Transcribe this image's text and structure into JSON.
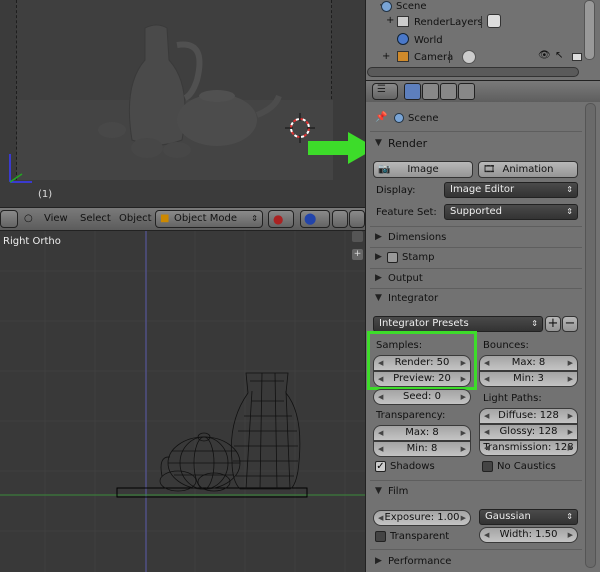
{
  "render_area": {
    "frame": "(1)"
  },
  "viewport_header": {
    "view": "View",
    "select": "Select",
    "object": "Object",
    "mode": "Object Mode"
  },
  "viewport": {
    "label": "Right Ortho"
  },
  "outliner": {
    "items": [
      {
        "label": "Scene"
      },
      {
        "label": "RenderLayers"
      },
      {
        "label": "World"
      },
      {
        "label": "Camera"
      }
    ]
  },
  "properties": {
    "context": "Scene",
    "render": {
      "title": "Render",
      "image_btn": "Image",
      "animation_btn": "Animation",
      "display_label": "Display:",
      "display_value": "Image Editor",
      "feature_label": "Feature Set:",
      "feature_value": "Supported"
    },
    "dimensions": "Dimensions",
    "stamp": "Stamp",
    "output": "Output",
    "integrator": {
      "title": "Integrator",
      "presets": "Integrator Presets",
      "samples_label": "Samples:",
      "render": "Render: 50",
      "preview": "Preview: 20",
      "seed": "Seed: 0",
      "bounces_label": "Bounces:",
      "max": "Max: 8",
      "min": "Min: 3",
      "transparency_label": "Transparency:",
      "t_max": "Max: 8",
      "t_min": "Min: 8",
      "light_paths_label": "Light Paths:",
      "diffuse": "Diffuse: 128",
      "glossy": "Glossy: 128",
      "transmission": "Transmission: 128",
      "shadows": "Shadows",
      "no_caustics": "No Caustics"
    },
    "film": {
      "title": "Film",
      "exposure": "Exposure: 1.00",
      "filter": "Gaussian",
      "transparent": "Transparent",
      "width": "Width: 1.50"
    },
    "performance": "Performance"
  },
  "colors": {
    "highlight": "#3ddc2a",
    "arrow": "#3ddc2a"
  }
}
